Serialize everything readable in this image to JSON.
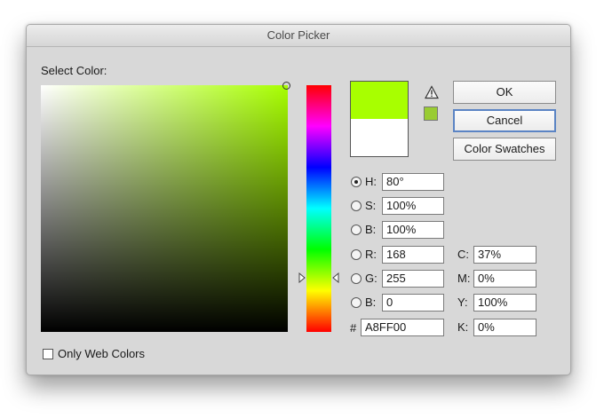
{
  "dialog": {
    "title": "Color Picker",
    "select_label": "Select Color:",
    "web_colors_label": "Only Web Colors",
    "new_color": "#a8ff00",
    "current_color": "#ffffff",
    "websafe_color": "#99cc33"
  },
  "buttons": {
    "ok": "OK",
    "cancel": "Cancel",
    "swatches": "Color Swatches"
  },
  "hsb": [
    {
      "label": "H:",
      "value": "80°",
      "selected": true
    },
    {
      "label": "S:",
      "value": "100%",
      "selected": false
    },
    {
      "label": "B:",
      "value": "100%",
      "selected": false
    }
  ],
  "rgb": [
    {
      "label": "R:",
      "value": "168",
      "selected": false
    },
    {
      "label": "G:",
      "value": "255",
      "selected": false
    },
    {
      "label": "B:",
      "value": "0",
      "selected": false
    }
  ],
  "hex": {
    "label": "#",
    "value": "A8FF00"
  },
  "cmyk": [
    {
      "label": "C:",
      "value": "37%"
    },
    {
      "label": "M:",
      "value": "0%"
    },
    {
      "label": "Y:",
      "value": "100%"
    },
    {
      "label": "K:",
      "value": "0%"
    }
  ],
  "icons": {
    "warning": "warning-triangle-icon"
  }
}
